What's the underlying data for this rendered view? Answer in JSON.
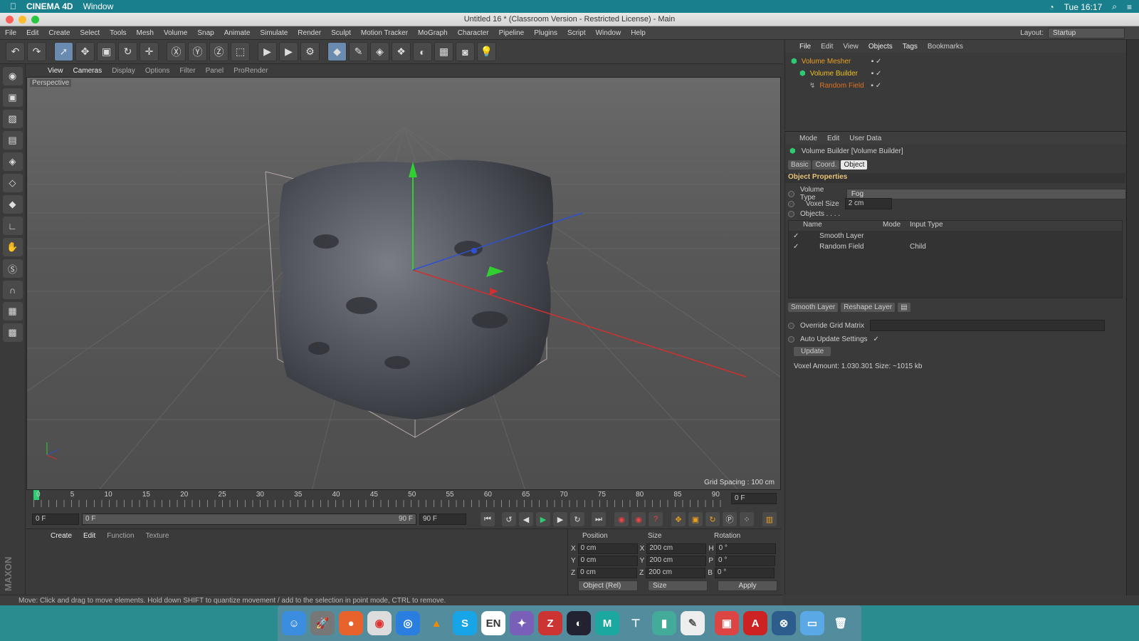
{
  "macbar": {
    "app": "CINEMA 4D",
    "menu": "Window",
    "time": "Tue 16:17"
  },
  "window": {
    "title": "Untitled 16 * (Classroom Version - Restricted License) - Main"
  },
  "appmenu": {
    "items": [
      "File",
      "Edit",
      "Create",
      "Select",
      "Tools",
      "Mesh",
      "Volume",
      "Snap",
      "Animate",
      "Simulate",
      "Render",
      "Sculpt",
      "Motion Tracker",
      "MoGraph",
      "Character",
      "Pipeline",
      "Plugins",
      "Script",
      "Window",
      "Help"
    ],
    "layout_label": "Layout:",
    "layout_value": "Startup"
  },
  "viewport": {
    "menu": [
      "View",
      "Cameras",
      "Display",
      "Options",
      "Filter",
      "Panel",
      "ProRender"
    ],
    "camera": "Perspective",
    "grid_spacing": "Grid Spacing : 100 cm"
  },
  "timeline": {
    "ticks": [
      "0",
      "5",
      "10",
      "15",
      "20",
      "25",
      "30",
      "35",
      "40",
      "45",
      "50",
      "55",
      "60",
      "65",
      "70",
      "75",
      "80",
      "85",
      "90"
    ],
    "end_frame": "0 F",
    "start_field": "0 F",
    "range_start": "0 F",
    "range_end": "90 F",
    "max_field": "90 F"
  },
  "material": {
    "menu": [
      "Create",
      "Edit",
      "Function",
      "Texture"
    ]
  },
  "coords": {
    "headers": [
      "Position",
      "Size",
      "Rotation"
    ],
    "rows": [
      {
        "axis": "X",
        "pos": "0 cm",
        "saxis": "X",
        "size": "200 cm",
        "raxis": "H",
        "rot": "0 °"
      },
      {
        "axis": "Y",
        "pos": "0 cm",
        "saxis": "Y",
        "size": "200 cm",
        "raxis": "P",
        "rot": "0 °"
      },
      {
        "axis": "Z",
        "pos": "0 cm",
        "saxis": "Z",
        "size": "200 cm",
        "raxis": "B",
        "rot": "0 °"
      }
    ],
    "mode": "Object (Rel)",
    "size_mode": "Size",
    "apply": "Apply"
  },
  "status": "Move: Click and drag to move elements. Hold down SHIFT to quantize movement / add to the selection in point mode, CTRL to remove.",
  "objects": {
    "menu": [
      "File",
      "Edit",
      "View",
      "Objects",
      "Tags",
      "Bookmarks"
    ],
    "items": [
      {
        "name": "Volume Mesher",
        "color": "#e8a020"
      },
      {
        "name": "Volume Builder",
        "color": "#f0c020"
      },
      {
        "name": "Random Field",
        "color": "#e07020"
      }
    ]
  },
  "attributes": {
    "menu": [
      "Mode",
      "Edit",
      "User Data"
    ],
    "title": "Volume Builder [Volume Builder]",
    "tabs": [
      "Basic",
      "Coord.",
      "Object"
    ],
    "section": "Object Properties",
    "volume_type_label": "Volume Type",
    "volume_type": "Fog",
    "voxel_size_label": "Voxel Size",
    "voxel_size": "2 cm",
    "objects_label": "Objects . . . .",
    "list_headers": [
      "Name",
      "Mode",
      "Input Type"
    ],
    "list": [
      {
        "name": "Smooth Layer",
        "input": ""
      },
      {
        "name": "Random Field",
        "input": "Child"
      }
    ],
    "layer_buttons": [
      "Smooth Layer",
      "Reshape Layer"
    ],
    "override": "Override Grid Matrix",
    "auto_update": "Auto Update Settings",
    "update": "Update",
    "voxel_info": "Voxel Amount: 1.030.301   Size: ~1015 kb"
  },
  "dock": {
    "en_label": "EN",
    "maya_label": "M"
  }
}
